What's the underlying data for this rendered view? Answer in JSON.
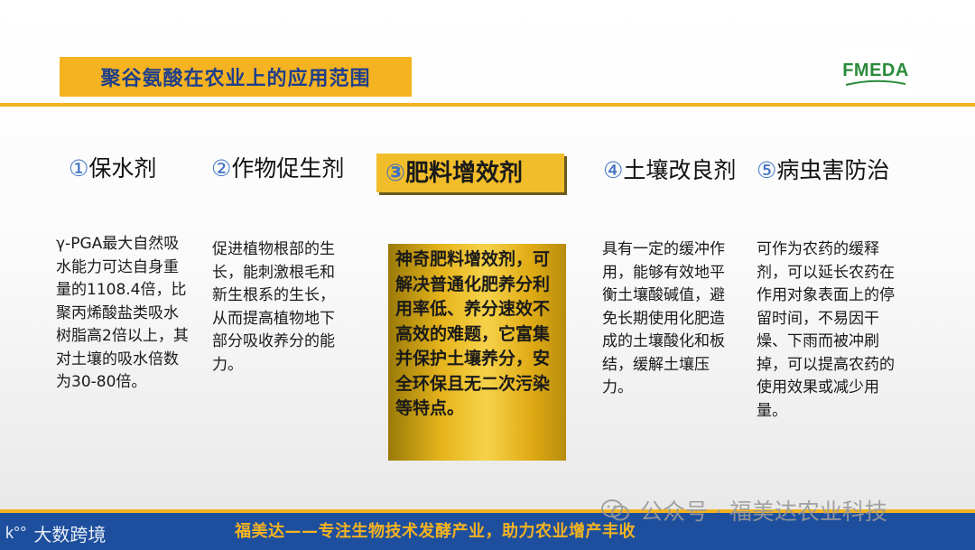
{
  "header": {
    "title": "聚谷氨酸在农业上的应用范围",
    "logo": "FMEDA"
  },
  "columns": [
    {
      "num": "①",
      "title": "保水剂",
      "body": "γ-PGA最大自然吸水能力可达自身重量的1108.4倍，比聚丙烯酸盐类吸水树脂高2倍以上，其对土壤的吸水倍数为30-80倍。"
    },
    {
      "num": "②",
      "title": "作物促生剂",
      "body": "促进植物根部的生长，能刺激根毛和新生根系的生长，从而提高植物地下部分吸收养分的能力。"
    },
    {
      "num": "③",
      "title": "肥料增效剂",
      "body": "神奇肥料增效剂，可解决普通化肥养分利用率低、养分速效不高效的难题，它富集并保护土壤养分，安全环保且无二次污染等特点。"
    },
    {
      "num": "④",
      "title": "土壤改良剂",
      "body": "具有一定的缓冲作用，能够有效地平衡土壤酸碱值，避免长期使用化肥造成的土壤酸化和板结，缓解土壤压力。"
    },
    {
      "num": "⑤",
      "title": "病虫害防治",
      "body": "可作为农药的缓释剂，可以延长农药在作用对象表面上的停留时间，不易因干燥、下雨而被冲刷掉，可以提高农药的使用效果或减少用量。"
    }
  ],
  "footer": {
    "slogan": "福美达——专注生物技术发酵产业，助力农业增产丰收",
    "brand_mark": "k°°",
    "brand": "大数跨境"
  },
  "watermark": {
    "text": "公众号 · 福美达农业科技",
    "icon": "wechat-icon"
  },
  "colors": {
    "accent": "#f5b321",
    "title_text": "#1f3f8a",
    "footer_bg": "#1d4f9e",
    "logo": "#2a8b3a"
  }
}
